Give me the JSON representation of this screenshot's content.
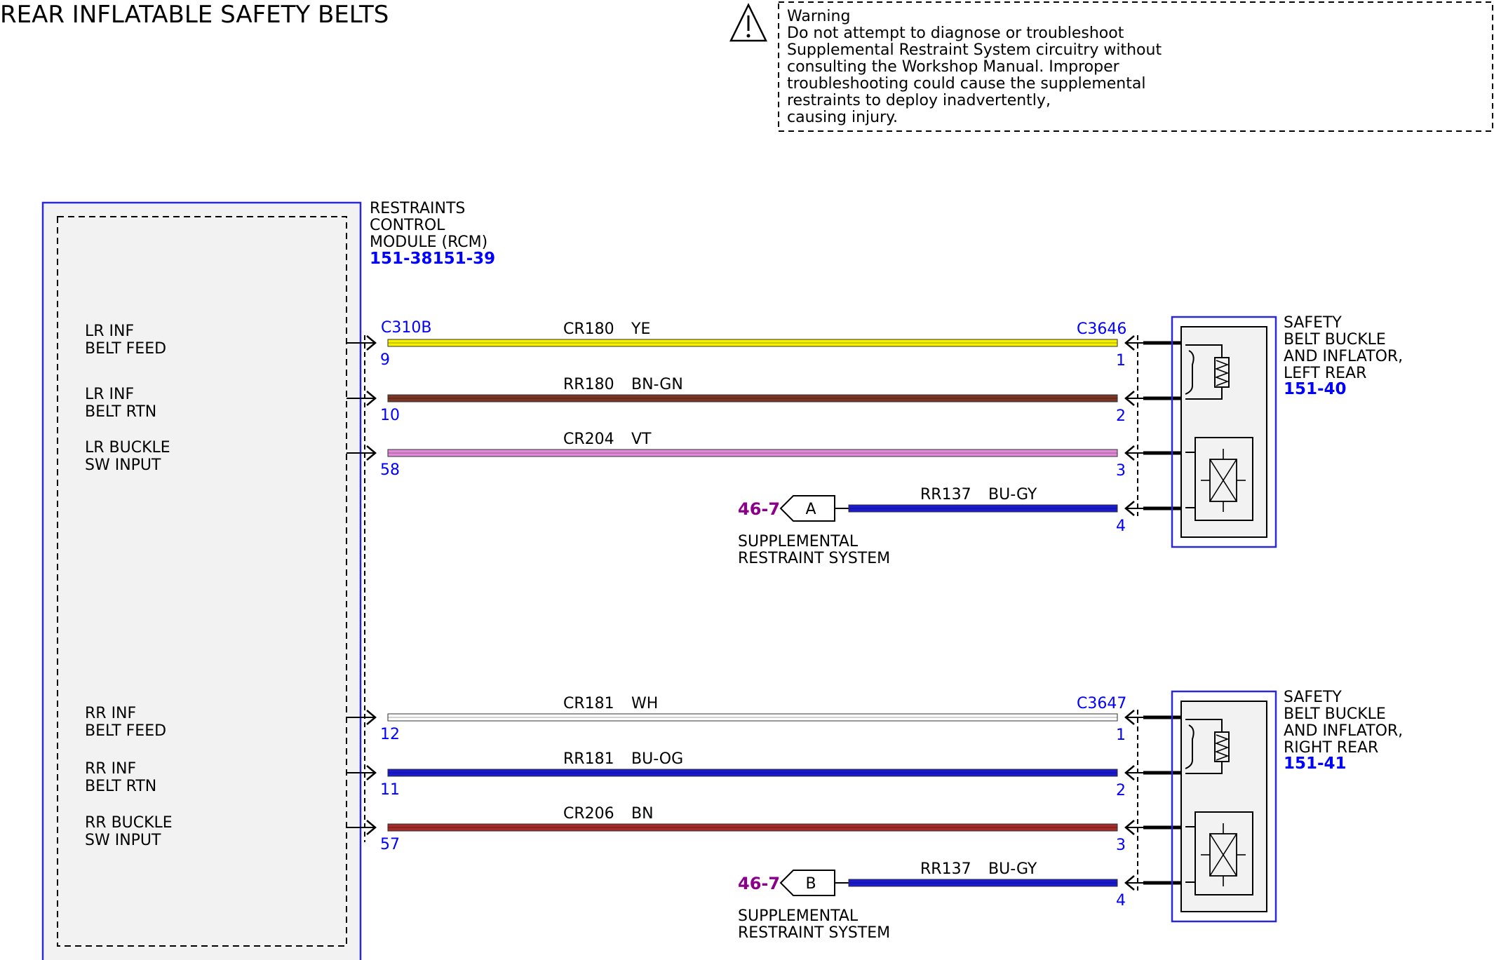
{
  "title": "REAR INFLATABLE SAFETY BELTS",
  "warning": {
    "lines": [
      "Warning",
      "Do not attempt to diagnose or troubleshoot",
      "Supplemental Restraint System circuitry without",
      "consulting the Workshop Manual. Improper",
      "troubleshooting could cause the supplemental",
      "restraints to deploy inadvertently,",
      "causing injury."
    ],
    "icon": "warning-triangle-icon"
  },
  "rcm": {
    "name_lines": [
      "RESTRAINTS",
      "CONTROL",
      "MODULE (RCM)"
    ],
    "ref": "151-38151-39",
    "connector": "C310B",
    "pins": [
      {
        "label1": "LR INF",
        "label2": "BELT FEED"
      },
      {
        "label1": "LR INF",
        "label2": "BELT RTN"
      },
      {
        "label1": "LR BUCKLE",
        "label2": "SW INPUT"
      },
      {
        "label1": "RR INF",
        "label2": "BELT FEED"
      },
      {
        "label1": "RR INF",
        "label2": "BELT RTN"
      },
      {
        "label1": "RR BUCKLE",
        "label2": "SW INPUT"
      }
    ]
  },
  "wires": [
    {
      "circuit": "CR180",
      "color_code": "YE",
      "rcm_pin": "9",
      "comp_pin": "1",
      "color": "#f5f000"
    },
    {
      "circuit": "RR180",
      "color_code": "BN-GN",
      "rcm_pin": "10",
      "comp_pin": "2",
      "color": "#7a3526"
    },
    {
      "circuit": "CR204",
      "color_code": "VT",
      "rcm_pin": "58",
      "comp_pin": "3",
      "color": "#e08ad8"
    },
    {
      "circuit": "RR137",
      "color_code": "BU-GY",
      "rcm_pin": "",
      "comp_pin": "4",
      "color": "#1a1ad0"
    },
    {
      "circuit": "CR181",
      "color_code": "WH",
      "rcm_pin": "12",
      "comp_pin": "1",
      "color": "#ffffff"
    },
    {
      "circuit": "RR181",
      "color_code": "BU-OG",
      "rcm_pin": "11",
      "comp_pin": "2",
      "color": "#1a1ad0"
    },
    {
      "circuit": "CR206",
      "color_code": "BN",
      "rcm_pin": "57",
      "comp_pin": "3",
      "color": "#a52a2a"
    },
    {
      "circuit": "RR137",
      "color_code": "BU-GY",
      "rcm_pin": "",
      "comp_pin": "4",
      "color": "#1a1ad0"
    }
  ],
  "components": [
    {
      "name_lines": [
        "SAFETY",
        "BELT BUCKLE",
        "AND INFLATOR,",
        "LEFT REAR"
      ],
      "ref": "151-40",
      "connector": "C3646"
    },
    {
      "name_lines": [
        "SAFETY",
        "BELT BUCKLE",
        "AND INFLATOR,",
        "RIGHT REAR"
      ],
      "ref": "151-41",
      "connector": "C3647"
    }
  ],
  "srs_links": [
    {
      "page": "46-7",
      "letter": "A",
      "label_lines": [
        "SUPPLEMENTAL",
        "RESTRAINT SYSTEM"
      ]
    },
    {
      "page": "46-7",
      "letter": "B",
      "label_lines": [
        "SUPPLEMENTAL",
        "RESTRAINT SYSTEM"
      ]
    }
  ]
}
